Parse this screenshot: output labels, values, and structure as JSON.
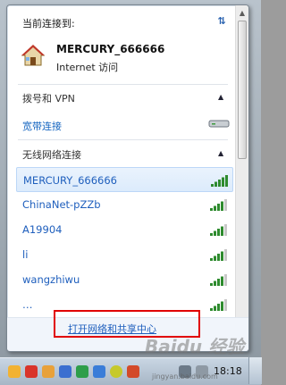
{
  "current": {
    "title": "当前连接到:",
    "network_name": "MERCURY_666666",
    "status": "Internet 访问"
  },
  "sections": {
    "dialup_title": "拨号和 VPN",
    "dialup_item": "宽带连接",
    "wireless_title": "无线网络连接"
  },
  "networks": [
    {
      "name": "MERCURY_666666",
      "selected": true,
      "signal": 5
    },
    {
      "name": "ChinaNet-pZZb",
      "selected": false,
      "signal": 4
    },
    {
      "name": "A19904",
      "selected": false,
      "signal": 4
    },
    {
      "name": "li",
      "selected": false,
      "signal": 4
    },
    {
      "name": "wangzhiwu",
      "selected": false,
      "signal": 4
    },
    {
      "name": "…",
      "selected": false,
      "signal": 4
    }
  ],
  "footer": {
    "link": "打开网络和共享中心"
  },
  "taskbar": {
    "time": "18:18"
  },
  "watermark": {
    "logo": "Baidu 经验",
    "url": "jingyan.baidu.com"
  },
  "colors": {
    "link": "#1f5fbd",
    "highlight_box": "#e10000",
    "signal": "#2e8b2e"
  }
}
